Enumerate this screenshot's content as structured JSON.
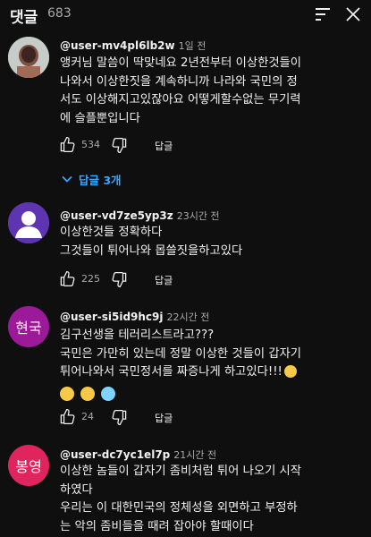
{
  "header": {
    "title": "댓글",
    "count": "683"
  },
  "comments": [
    {
      "handle": "@user-mv4pl6lb2w",
      "time": "1일 전",
      "lines": [
        "앵커님 말씀이 딱맞네요  2년전부터 이상한것들이",
        "나와서 이상한짓을 계속하니까 나라와 국민의 정",
        "서도 이상해지고있잖아요  어떻게할수없는 무기력",
        "에 슬플뿐입니다"
      ],
      "likes": "534",
      "reply_label": "답글",
      "replies_label": "답글 3개"
    },
    {
      "handle": "@user-vd7ze5yp3z",
      "time": "23시간 전",
      "lines": [
        "이상한것들 정확하다",
        "그것들이 튀어나와 몹쓸짓을하고있다"
      ],
      "likes": "225",
      "reply_label": "답글"
    },
    {
      "handle": "@user-si5id9hc9j",
      "time": "22시간 전",
      "avatar_text": "현국",
      "avatar_color": "#9c1a9a",
      "lines": [
        "김구선생을 테러리스트라고???",
        "국민은 가만히 있는데 정말 이상한 것들이 갑자기",
        "튀어나와서 국민정서를 짜증나게 하고있다!!!"
      ],
      "likes": "24",
      "reply_label": "답글"
    },
    {
      "handle": "@user-dc7yc1el7p",
      "time": "21시간 전",
      "avatar_text": "봉영",
      "avatar_color": "#e0245e",
      "lines": [
        "이상한 놈들이 갑자기 좀비처럼 튀어 나오기 시작",
        "하였다",
        "우리는 이 대한민국의 정체성을 외면하고 부정하",
        "는 악의 좀비들을 때려 잡아야 할때이다"
      ]
    }
  ]
}
